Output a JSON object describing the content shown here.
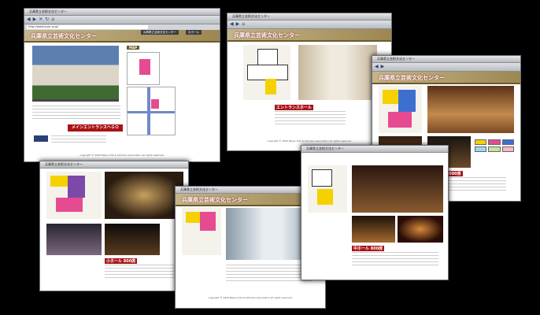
{
  "site": {
    "window_title": "兵庫県立芸術文化センター",
    "url": "http://www.hpac.or.jp/",
    "banner_title": "兵庫県立芸術文化センター",
    "top_nav": [
      "兵庫県立芸術文化センター",
      "大ホール"
    ],
    "map_label": "MAP",
    "main_entrance_button": "メインエントランスへＧＯ",
    "copyright": "copyright © 2005 Nippo Arts & Scholars Association all rights reserved.",
    "flash_badge": "Get MACROMEDIA FLASH PLAYER"
  },
  "pages": {
    "entrance_heading": "エントランスホール",
    "small_hall_heading": "小ホール 800席",
    "middle_hall_heading": "中ホール 800席",
    "large_hall_heading": "大ホール 2000席"
  },
  "toolbar": {
    "back": "◀",
    "forward": "▶",
    "stop": "✕",
    "refresh": "↻",
    "home": "⌂"
  },
  "colors": {
    "banner_gold": "#b19e68",
    "accent_red": "#a81216",
    "plan_pink": "#e64b91",
    "plan_yellow": "#f5d100",
    "plan_blue": "#3d6fd1",
    "plan_purple": "#7b4aa8"
  }
}
